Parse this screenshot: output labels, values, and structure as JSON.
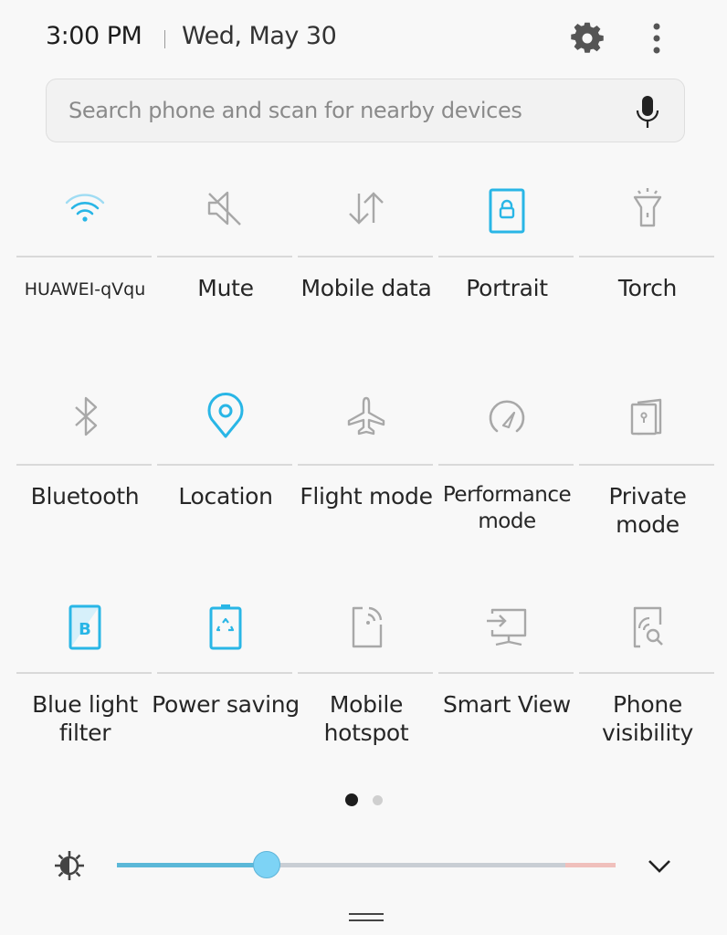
{
  "status": {
    "time": "3:00 PM",
    "date": "Wed, May 30"
  },
  "header": {
    "settings_icon": "gear-icon",
    "more_icon": "more-vertical-icon"
  },
  "search": {
    "placeholder": "Search phone and scan for nearby devices",
    "value": "",
    "mic_icon": "microphone-icon"
  },
  "colors": {
    "active": "#29b6e6",
    "inactive": "#a8a8a8",
    "slider_fill": "#5bb8d8",
    "slider_thumb": "#7dd3f5",
    "slider_track": "#c9ced4",
    "slider_high": "#f0c0bc"
  },
  "tiles": [
    {
      "label": "HUAWEI-qVqu",
      "icon": "wifi-icon",
      "active": true
    },
    {
      "label": "Mute",
      "icon": "mute-icon",
      "active": false
    },
    {
      "label": "Mobile data",
      "icon": "mobile-data-icon",
      "active": false
    },
    {
      "label": "Portrait",
      "icon": "portrait-lock-icon",
      "active": true
    },
    {
      "label": "Torch",
      "icon": "torch-icon",
      "active": false
    },
    {
      "label": "Bluetooth",
      "icon": "bluetooth-icon",
      "active": false
    },
    {
      "label": "Location",
      "icon": "location-icon",
      "active": true
    },
    {
      "label": "Flight mode",
      "icon": "airplane-icon",
      "active": false
    },
    {
      "label": "Performance mode",
      "icon": "speedometer-icon",
      "active": false
    },
    {
      "label": "Private mode",
      "icon": "private-mode-icon",
      "active": false
    },
    {
      "label": "Blue light filter",
      "icon": "blue-light-filter-icon",
      "active": true
    },
    {
      "label": "Power saving",
      "icon": "power-saving-icon",
      "active": true
    },
    {
      "label": "Mobile hotspot",
      "icon": "hotspot-icon",
      "active": false
    },
    {
      "label": "Smart View",
      "icon": "smart-view-icon",
      "active": false
    },
    {
      "label": "Phone visibility",
      "icon": "phone-visibility-icon",
      "active": false
    }
  ],
  "pagination": {
    "current": 1,
    "total": 2
  },
  "brightness": {
    "level": 0.3,
    "high_zone_start": 0.9,
    "icon": "brightness-icon",
    "expand_icon": "chevron-down-icon"
  },
  "drawer": {
    "handle_icon": "drag-handle-icon"
  }
}
